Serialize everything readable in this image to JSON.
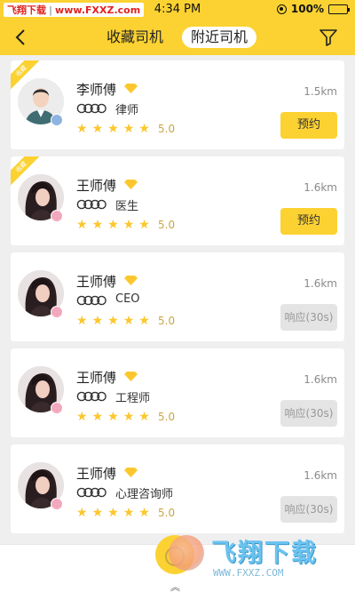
{
  "status_bar": {
    "brand": "飞翔下载",
    "url": "www.FXXZ.com",
    "time": "4:34 PM",
    "battery": "100%"
  },
  "header": {
    "tabs": [
      {
        "label": "收藏司机",
        "active": false
      },
      {
        "label": "附近司机",
        "active": true
      }
    ]
  },
  "drivers": [
    {
      "name": "李师傅",
      "profession": "律师",
      "rating": "5.0",
      "distance": "1.5km",
      "action": "预约",
      "action_type": "book",
      "ribbon": "收藏",
      "gender": "male"
    },
    {
      "name": "王师傅",
      "profession": "医生",
      "rating": "5.0",
      "distance": "1.6km",
      "action": "预约",
      "action_type": "book",
      "ribbon": "收藏",
      "gender": "female"
    },
    {
      "name": "王师傅",
      "profession": "CEO",
      "rating": "5.0",
      "distance": "1.6km",
      "action": "响应(30s)",
      "action_type": "response",
      "ribbon": "",
      "gender": "female"
    },
    {
      "name": "王师傅",
      "profession": "工程师",
      "rating": "5.0",
      "distance": "1.6km",
      "action": "响应(30s)",
      "action_type": "response",
      "ribbon": "",
      "gender": "female"
    },
    {
      "name": "王师傅",
      "profession": "心理咨询师",
      "rating": "5.0",
      "distance": "1.6km",
      "action": "响应(30s)",
      "action_type": "response",
      "ribbon": "",
      "gender": "female"
    }
  ],
  "watermark": {
    "title": "飞翔下载",
    "url": "WWW.FXXZ.COM"
  },
  "colors": {
    "accent": "#fbd232",
    "star": "#fbc72c"
  }
}
